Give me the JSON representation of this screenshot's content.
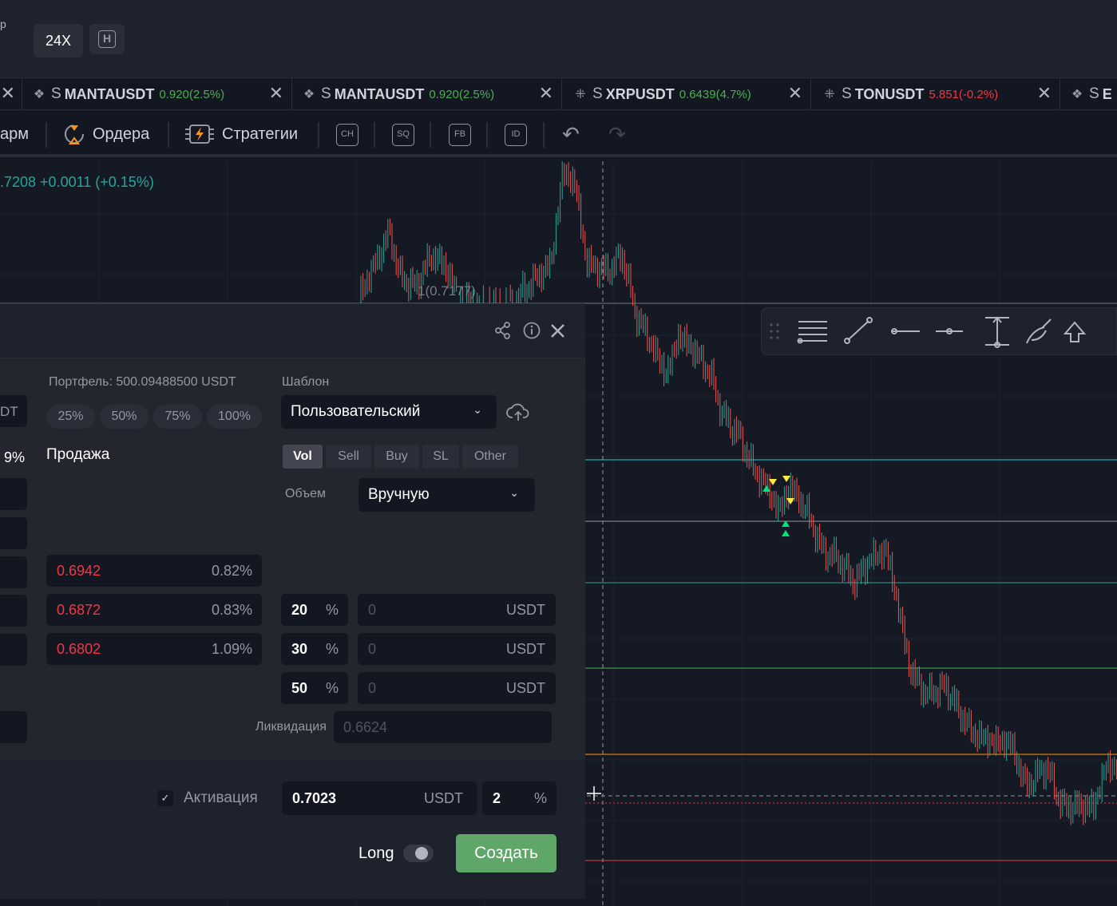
{
  "top": {
    "lead": "p",
    "leverage": "24X",
    "h_label": "H"
  },
  "tabs": [
    {
      "prefix": "S",
      "symbol": "MANTAUSDT",
      "price": "0.920(2.5%)",
      "dir": "up",
      "icon": "binance-icon"
    },
    {
      "prefix": "S",
      "symbol": "MANTAUSDT",
      "price": "0.920(2.5%)",
      "dir": "up",
      "icon": "binance-icon"
    },
    {
      "prefix": "S",
      "symbol": "XRPUSDT",
      "price": "0.6439(4.7%)",
      "dir": "up",
      "icon": "okx-icon"
    },
    {
      "prefix": "S",
      "symbol": "TONUSDT",
      "price": "5.851(-0.2%)",
      "dir": "down",
      "icon": "okx-icon"
    },
    {
      "prefix": "S",
      "symbol": "E",
      "price": "",
      "dir": "up",
      "icon": "binance-icon"
    }
  ],
  "toolbar": {
    "farm": "арм",
    "orders": "Ордера",
    "strategies": "Стратегии",
    "ch": "CH",
    "sq": "SQ",
    "fb": "FB",
    "id": "ID"
  },
  "chart": {
    "price_line": ".7208 +0.0011 (+0.15%)",
    "level_label": "1(0.7177)"
  },
  "panel": {
    "portfolio": "Портфель: 500.09488500 USDT",
    "template_label": "Шаблон",
    "template_value": "Пользовательский",
    "left_cut": "DT",
    "left_pct": "9%",
    "sell_title": "Продажа",
    "percent_buttons": [
      "25%",
      "50%",
      "75%",
      "100%"
    ],
    "chips": [
      "Vol",
      "Sell",
      "Buy",
      "SL",
      "Other"
    ],
    "volume_label": "Объем",
    "volume_value": "Вручную",
    "prices": [
      {
        "value": "0.6942",
        "pct": "0.82%"
      },
      {
        "value": "0.6872",
        "pct": "0.83%"
      },
      {
        "value": "0.6802",
        "pct": "1.09%"
      }
    ],
    "allocations": [
      {
        "pct": "20",
        "unit": "%",
        "amount": "0",
        "currency": "USDT"
      },
      {
        "pct": "30",
        "unit": "%",
        "amount": "0",
        "currency": "USDT"
      },
      {
        "pct": "50",
        "unit": "%",
        "amount": "0",
        "currency": "USDT"
      }
    ],
    "liquidation_label": "Ликвидация",
    "liquidation_value": "0.6624",
    "activation_label": "Активация",
    "activation_price": "0.7023",
    "activation_currency": "USDT",
    "activation_pct": "2",
    "activation_pct_unit": "%",
    "long_label": "Long",
    "create_label": "Создать"
  },
  "colors": {
    "up": "#4caf50",
    "down": "#f23645",
    "create": "#5ea769",
    "accent_orange": "#f7931a"
  }
}
